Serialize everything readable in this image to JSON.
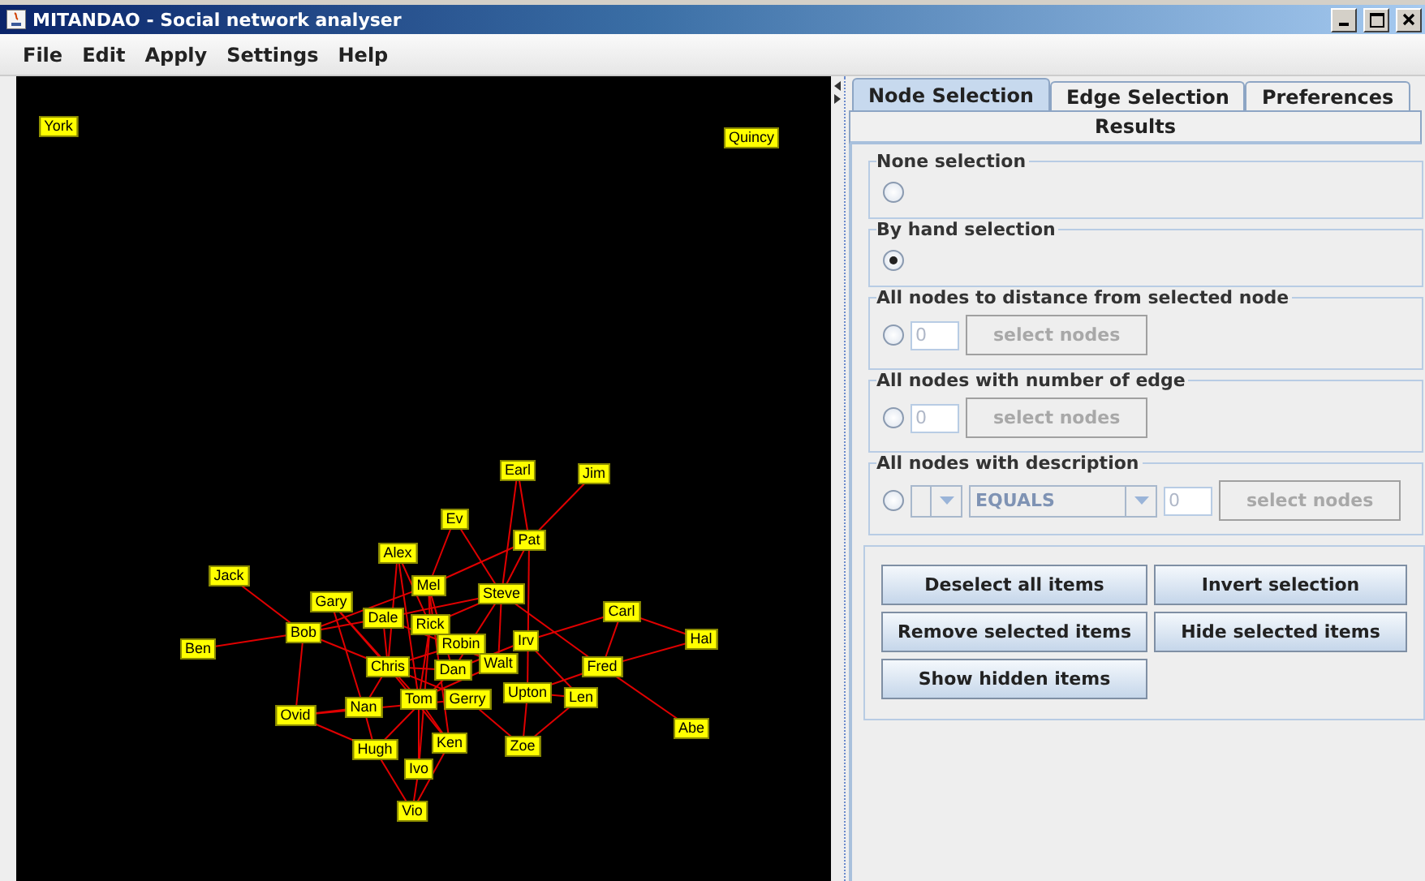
{
  "window": {
    "title": "MITANDAO - Social network analyser"
  },
  "menu": [
    "File",
    "Edit",
    "Apply",
    "Settings",
    "Help"
  ],
  "graph": {
    "nodes": [
      "York",
      "Quincy",
      "Earl",
      "Jim",
      "Ev",
      "Pat",
      "Alex",
      "Jack",
      "Mel",
      "Steve",
      "Gary",
      "Carl",
      "Dale",
      "Rick",
      "Ben",
      "Bob",
      "Robin",
      "Irv",
      "Hal",
      "Chris",
      "Dan",
      "Walt",
      "Fred",
      "Ovid",
      "Nan",
      "Tom",
      "Gerry",
      "Upton",
      "Len",
      "Abe",
      "Hugh",
      "Ken",
      "Zoe",
      "Ivo",
      "Vio"
    ]
  },
  "tabs": [
    {
      "label": "Node Selection",
      "selected": true
    },
    {
      "label": "Edge Selection",
      "selected": false
    },
    {
      "label": "Preferences",
      "selected": false
    },
    {
      "label": "Results",
      "selected": false
    }
  ],
  "groups": [
    {
      "kind": "plain",
      "title": "None selection",
      "selected": false
    },
    {
      "kind": "plain",
      "title": "By hand selection",
      "selected": true
    },
    {
      "kind": "number",
      "title": "All nodes to distance from selected node",
      "selected": false,
      "value": "0",
      "button": "select nodes",
      "disabled": true
    },
    {
      "kind": "number",
      "title": "All nodes with number of edge",
      "selected": false,
      "value": "0",
      "button": "select nodes",
      "disabled": true
    },
    {
      "kind": "description",
      "title": "All nodes with description",
      "selected": false,
      "operator": "EQUALS",
      "value": "0",
      "button": "select nodes",
      "disabled": true
    }
  ],
  "actions": [
    "Deselect all items",
    "Invert selection",
    "Remove selected items",
    "Hide selected items",
    "Show hidden items"
  ]
}
